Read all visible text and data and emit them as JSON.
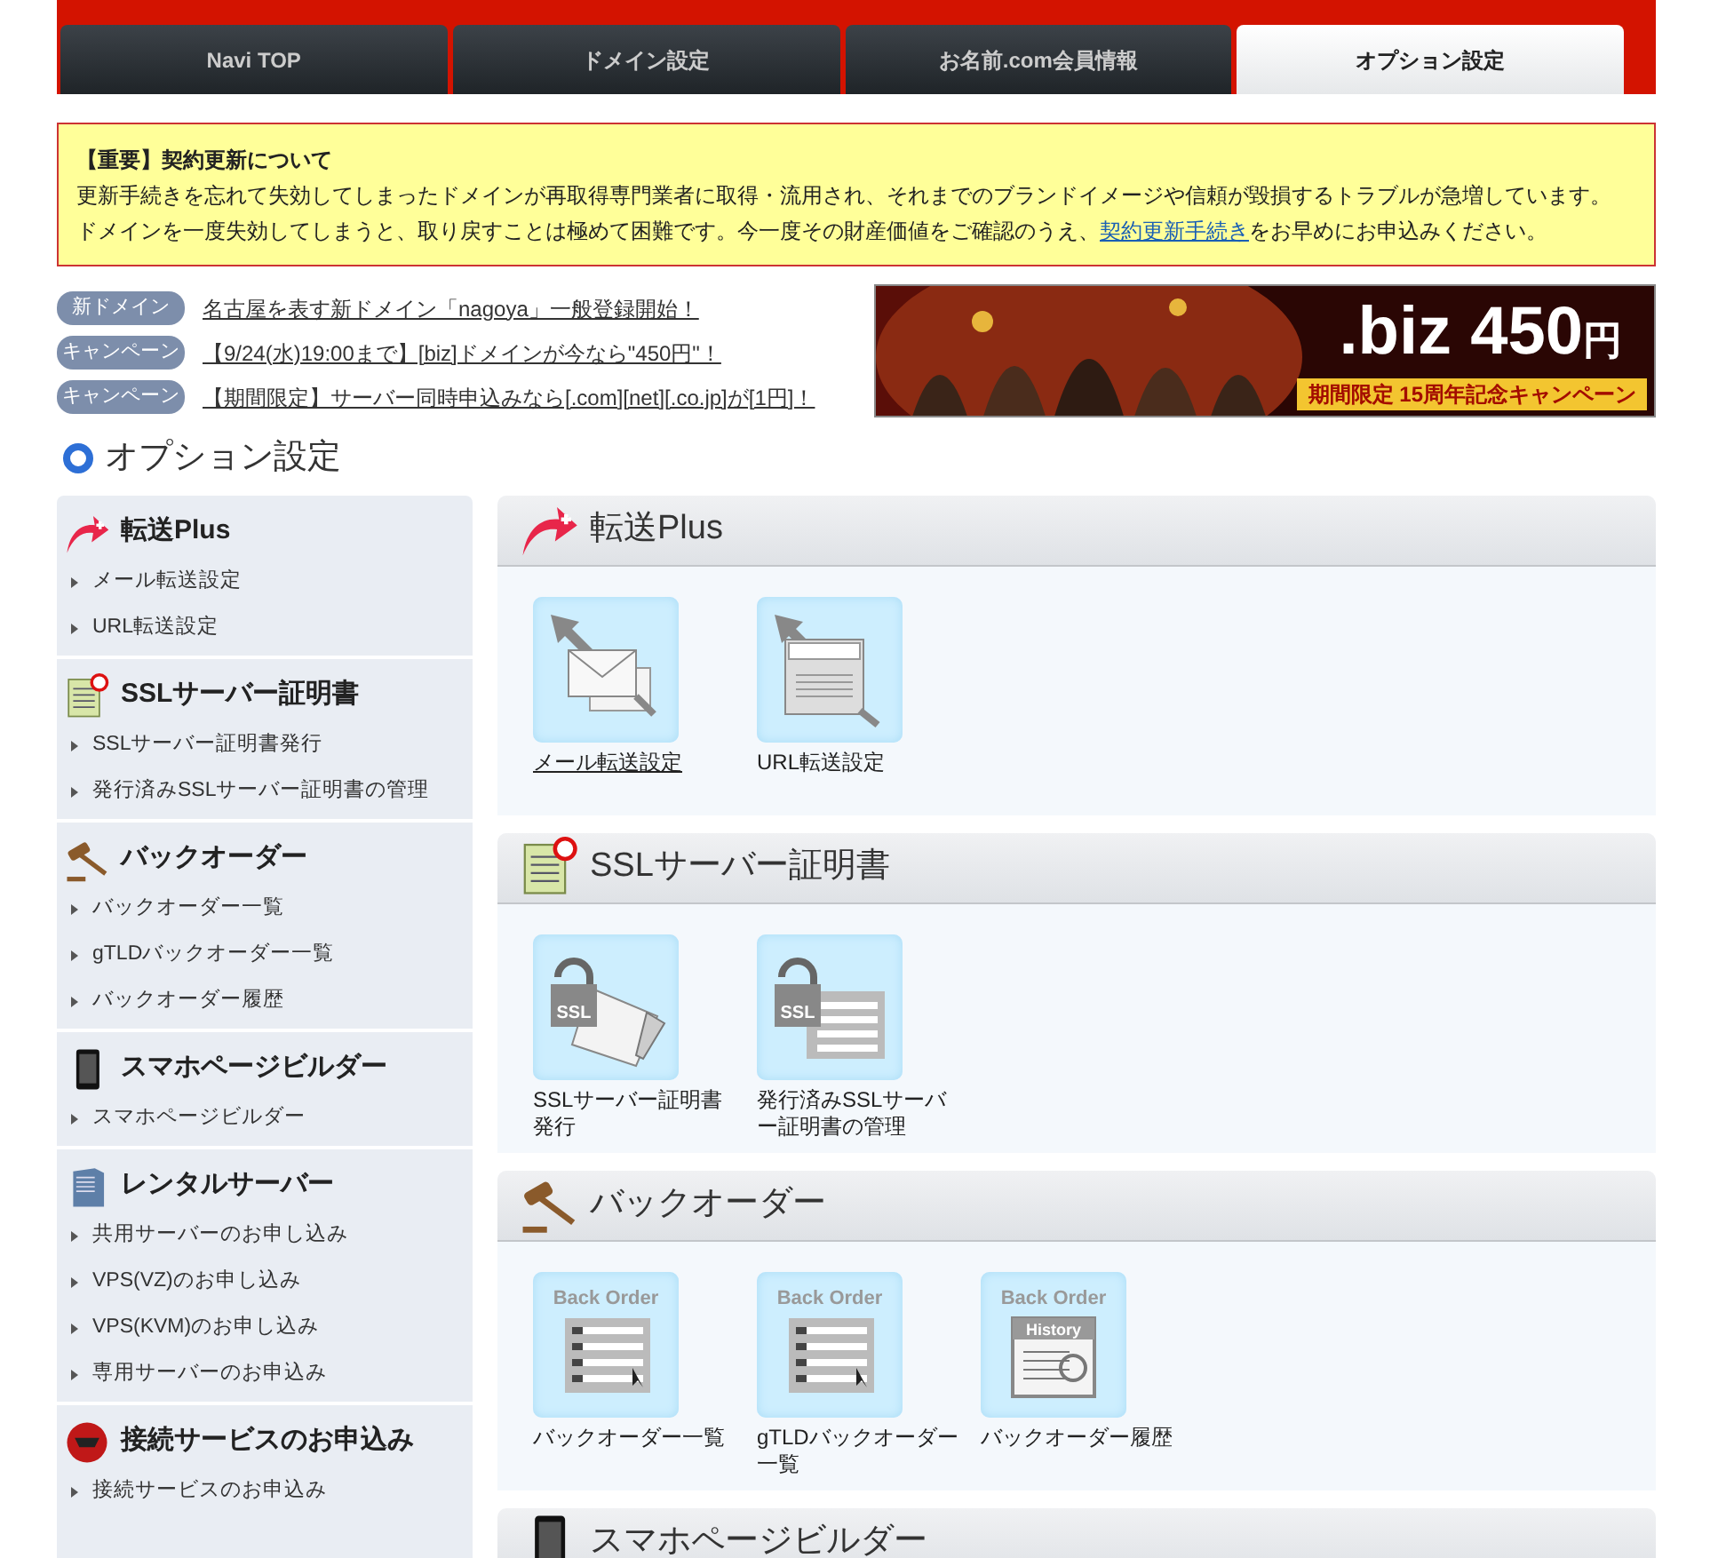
{
  "tabs": [
    {
      "label": "Navi TOP",
      "selected": false
    },
    {
      "label": "ドメイン設定",
      "selected": false
    },
    {
      "label": "お名前.com会員情報",
      "selected": false
    },
    {
      "label": "オプション設定",
      "selected": true
    }
  ],
  "notice": {
    "title": "【重要】契約更新について",
    "line_1": "更新手続きを忘れて失効してしまったドメインが再取得専門業者に取得・流用され、それまでのブランドイメージや信頼が毀損するトラブルが急増しています。",
    "line_2_before": "ドメインを一度失効してしまうと、取り戻すことは極めて困難です。今一度その財産価値をご確認のうえ、",
    "line_2_link": "契約更新手続き",
    "line_2_after": "をお早めにお申込みください。"
  },
  "news": [
    {
      "tag": "新ドメイン",
      "text": "名古屋を表す新ドメイン「nagoya」一般登録開始！"
    },
    {
      "tag": "キャンペーン",
      "text": "【9/24(水)19:00まで】[biz]ドメインが今なら\"450円\"！"
    },
    {
      "tag": "キャンペーン",
      "text": "【期間限定】サーバー同時申込みなら[.com][net][.co.jp]が[1円]！"
    }
  ],
  "banner": {
    "kind": "picture",
    "price": ".biz 450",
    "unit": "円",
    "caption": "期間限定 15周年記念キャンペーン"
  },
  "page_title": "オプション設定",
  "sidebar": {
    "groups": [
      {
        "title": "転送Plus",
        "kind": "forward",
        "items": [
          "メール転送設定",
          "URL転送設定"
        ]
      },
      {
        "title": "SSLサーバー証明書",
        "kind": "ssl",
        "items": [
          "SSLサーバー証明書発行",
          "発行済みSSLサーバー証明書の管理"
        ]
      },
      {
        "title": "バックオーダー",
        "kind": "gavel",
        "items": [
          "バックオーダー一覧",
          "gTLDバックオーダー一覧",
          "バックオーダー履歴"
        ]
      },
      {
        "title": "スマホページビルダー",
        "kind": "phone",
        "items": [
          "スマホページビルダー"
        ]
      },
      {
        "title": "レンタルサーバー",
        "kind": "server",
        "items": [
          "共用サーバーのお申し込み",
          "VPS(VZ)のお申し込み",
          "VPS(KVM)のお申し込み",
          "専用サーバーのお申込み"
        ]
      },
      {
        "title": "接続サービスのお申込み",
        "kind": "connect",
        "items": [
          "接続サービスのお申込み"
        ]
      }
    ]
  },
  "sections": [
    {
      "title": "転送Plus",
      "kind": "forward",
      "tiles": [
        {
          "label": "メール転送設定",
          "kind": "mail",
          "hovered": true
        },
        {
          "label": "URL転送設定",
          "kind": "url",
          "hovered": false
        }
      ]
    },
    {
      "title": "SSLサーバー証明書",
      "kind": "ssl",
      "tiles": [
        {
          "label": "SSLサーバー証明書発行",
          "kind": "ssl-issue",
          "icon_text": "SSL",
          "hovered": false
        },
        {
          "label": "発行済みSSLサーバー証明書の管理",
          "kind": "ssl-manage",
          "icon_text": "SSL",
          "hovered": false
        }
      ]
    },
    {
      "title": "バックオーダー",
      "kind": "gavel",
      "tiles": [
        {
          "label": "バックオーダー一覧",
          "kind": "backorder-list",
          "icon_text": "Back Order",
          "hovered": false
        },
        {
          "label": "gTLDバックオーダー一覧",
          "kind": "backorder-list",
          "icon_text": "Back Order",
          "hovered": false
        },
        {
          "label": "バックオーダー履歴",
          "kind": "backorder-history",
          "icon_text": "Back Order",
          "icon_subtext": "History",
          "hovered": false
        }
      ]
    },
    {
      "title": "スマホページビルダー",
      "kind": "phone"
    }
  ]
}
